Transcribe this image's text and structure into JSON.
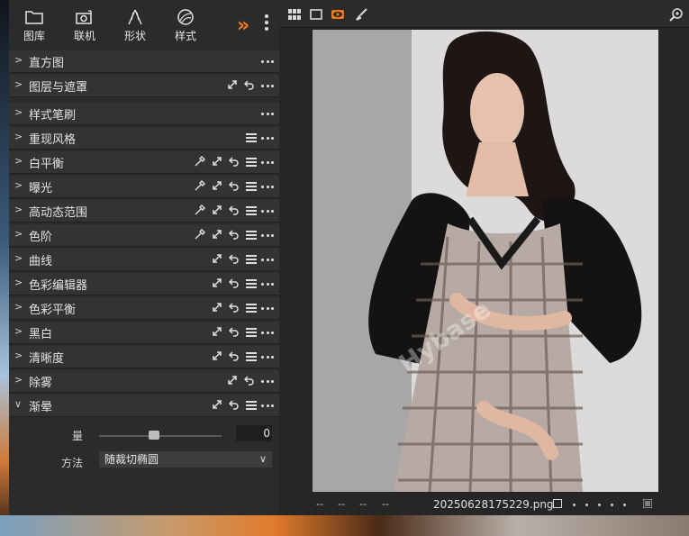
{
  "tool_tabs": [
    {
      "label": "图库",
      "icon": "folder-icon"
    },
    {
      "label": "联机",
      "icon": "camera-icon"
    },
    {
      "label": "形状",
      "icon": "shape-icon"
    },
    {
      "label": "样式",
      "icon": "style-icon"
    }
  ],
  "tools": [
    {
      "label": "直方图"
    },
    {
      "label": "图层与遮罩"
    },
    {
      "label": "样式笔刷"
    },
    {
      "label": "重现风格"
    },
    {
      "label": "白平衡"
    },
    {
      "label": "曝光"
    },
    {
      "label": "高动态范围"
    },
    {
      "label": "色阶"
    },
    {
      "label": "曲线"
    },
    {
      "label": "色彩编辑器"
    },
    {
      "label": "色彩平衡"
    },
    {
      "label": "黑白"
    },
    {
      "label": "清晰度"
    },
    {
      "label": "除雾"
    },
    {
      "label": "渐晕"
    }
  ],
  "vignette": {
    "amount_label": "量",
    "amount_value": "0",
    "slider_level": 0.45,
    "method_label": "方法",
    "method_value": "随裁切椭圆"
  },
  "status_bar": {
    "dash1": "--",
    "dash2": "--",
    "dash3": "--",
    "dash4": "--",
    "filename": "20250628175229.png"
  },
  "colors": {
    "accent": "#f07a1a",
    "panel": "#2b2b2b",
    "row": "#333333"
  }
}
